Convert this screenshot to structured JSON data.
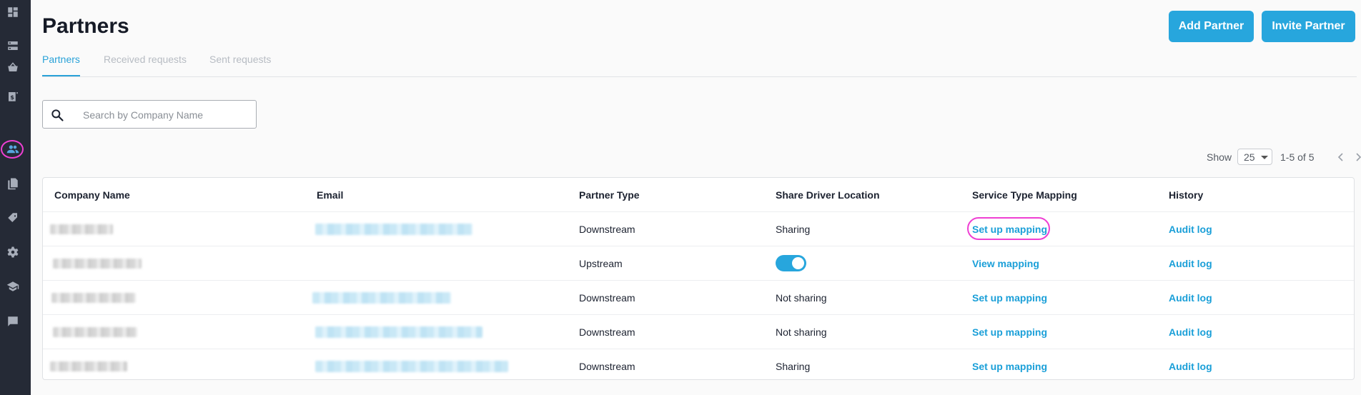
{
  "page": {
    "title": "Partners"
  },
  "header": {
    "add_partner_label": "Add Partner",
    "invite_partner_label": "Invite Partner"
  },
  "tabs": [
    {
      "label": "Partners",
      "active": true
    },
    {
      "label": "Received requests",
      "active": false
    },
    {
      "label": "Sent requests",
      "active": false
    }
  ],
  "search": {
    "placeholder": "Search by Company Name",
    "value": ""
  },
  "pagination": {
    "show_label": "Show",
    "page_size": "25",
    "range": "1-5 of 5"
  },
  "table": {
    "columns": [
      "Company Name",
      "Email",
      "Partner Type",
      "Share Driver Location",
      "Service Type Mapping",
      "History"
    ],
    "rows": [
      {
        "company": "",
        "email": "",
        "partner_type": "Downstream",
        "share_location": "Sharing",
        "mapping": "Set up mapping",
        "history": "Audit log"
      },
      {
        "company": "",
        "email": "",
        "partner_type": "Upstream",
        "share_location": "",
        "share_toggle_on": true,
        "mapping": "View mapping",
        "history": "Audit log"
      },
      {
        "company": "",
        "email": "",
        "partner_type": "Downstream",
        "share_location": "Not sharing",
        "mapping": "Set up mapping",
        "history": "Audit log"
      },
      {
        "company": "",
        "email": "",
        "partner_type": "Downstream",
        "share_location": "Not sharing",
        "mapping": "Set up mapping",
        "history": "Audit log"
      },
      {
        "company": "",
        "email": "",
        "partner_type": "Downstream",
        "share_location": "Sharing",
        "mapping": "Set up mapping",
        "history": "Audit log"
      }
    ]
  },
  "sidebar": {
    "items": [
      {
        "icon": "dashboard-icon"
      },
      {
        "icon": "server-icon"
      },
      {
        "icon": "basket-icon"
      },
      {
        "icon": "invoice-icon"
      },
      {
        "icon": "partners-icon",
        "active": true
      },
      {
        "icon": "documents-icon"
      },
      {
        "icon": "tag-icon"
      },
      {
        "icon": "gear-icon"
      },
      {
        "icon": "graduation-cap-icon"
      },
      {
        "icon": "chat-icon"
      }
    ]
  },
  "colors": {
    "accent": "#27a6dd",
    "sidebar": "#252a36",
    "highlight": "#ef3fd3"
  }
}
